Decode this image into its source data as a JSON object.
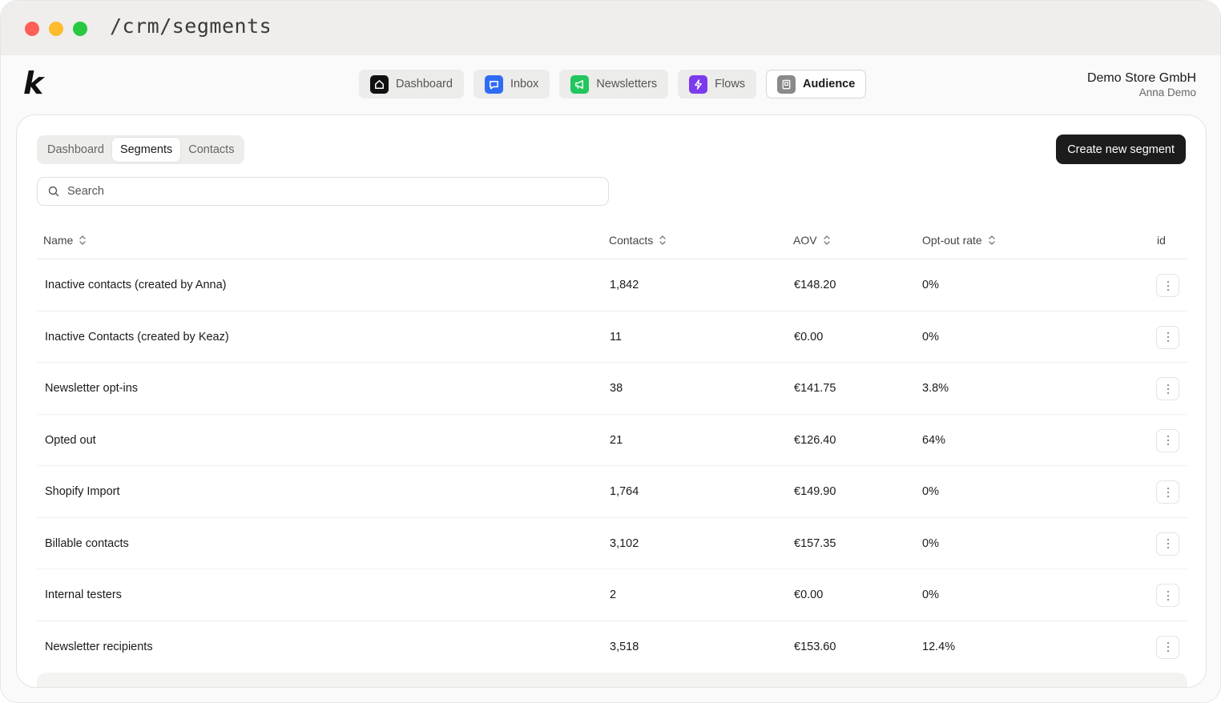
{
  "browser": {
    "url": "/crm/segments"
  },
  "app": {
    "logo_letter": "k",
    "nav": [
      {
        "label": "Dashboard",
        "icon": "home-icon",
        "color": "#111111"
      },
      {
        "label": "Inbox",
        "icon": "chat-bubble-icon",
        "color": "#2f6cf6"
      },
      {
        "label": "Newsletters",
        "icon": "megaphone-icon",
        "color": "#22c55e"
      },
      {
        "label": "Flows",
        "icon": "lightning-icon",
        "color": "#7c3aed"
      },
      {
        "label": "Audience",
        "icon": "contact-card-icon",
        "color": "#8a8a8a",
        "active": true
      }
    ],
    "account": {
      "store": "Demo Store GmbH",
      "user": "Anna Demo"
    }
  },
  "subnav": {
    "tabs": [
      {
        "label": "Dashboard"
      },
      {
        "label": "Segments",
        "active": true
      },
      {
        "label": "Contacts"
      }
    ],
    "create_label": "Create new segment"
  },
  "search": {
    "placeholder": "Search",
    "value": ""
  },
  "table": {
    "columns": [
      "Name",
      "Contacts",
      "AOV",
      "Opt-out rate",
      "id"
    ],
    "rows": [
      {
        "name": "Inactive contacts (created by Anna)",
        "contacts": "1,842",
        "aov": "€148.20",
        "opt_out": "0%"
      },
      {
        "name": "Inactive Contacts (created by Keaz)",
        "contacts": "11",
        "aov": "€0.00",
        "opt_out": "0%"
      },
      {
        "name": "Newsletter opt-ins",
        "contacts": "38",
        "aov": "€141.75",
        "opt_out": "3.8%"
      },
      {
        "name": "Opted out",
        "contacts": "21",
        "aov": "€126.40",
        "opt_out": "64%"
      },
      {
        "name": "Shopify Import",
        "contacts": "1,764",
        "aov": "€149.90",
        "opt_out": "0%"
      },
      {
        "name": "Billable contacts",
        "contacts": "3,102",
        "aov": "€157.35",
        "opt_out": "0%"
      },
      {
        "name": "Internal testers",
        "contacts": "2",
        "aov": "€0.00",
        "opt_out": "0%"
      },
      {
        "name": "Newsletter recipients",
        "contacts": "3,518",
        "aov": "€153.60",
        "opt_out": "12.4%"
      }
    ]
  }
}
